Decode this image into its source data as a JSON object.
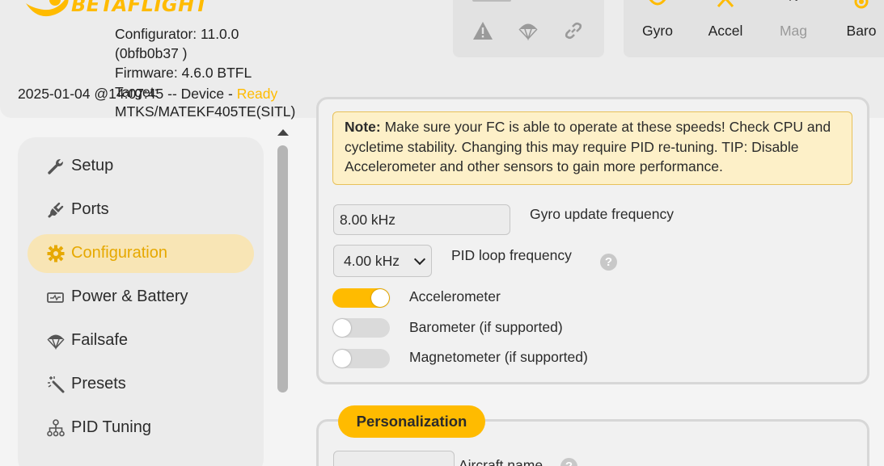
{
  "header": {
    "logo_text": "BETAFLIGHT",
    "configurator": "Configurator: 11.0.0",
    "build": "(0bfb0b37 )",
    "firmware": "Firmware: 4.6.0 BTFL",
    "target_label": "Target:",
    "target_value": "MTKS/MATEKF405TE(SITL)",
    "status_prefix": "2025-01-04 @14:07:45 -- Device - ",
    "status_ready": "Ready",
    "status_icons": [
      "warning-icon",
      "parachute-icon",
      "link-icon"
    ],
    "sensors": [
      {
        "label": "Gyro",
        "active": true
      },
      {
        "label": "Accel",
        "active": true
      },
      {
        "label": "Mag",
        "active": false
      },
      {
        "label": "Baro",
        "active": true
      }
    ]
  },
  "sidebar": {
    "items": [
      {
        "label": "Setup",
        "icon": "wrench-icon",
        "active": false
      },
      {
        "label": "Ports",
        "icon": "plug-icon",
        "active": false
      },
      {
        "label": "Configuration",
        "icon": "gear-icon",
        "active": true
      },
      {
        "label": "Power & Battery",
        "icon": "battery-icon",
        "active": false
      },
      {
        "label": "Failsafe",
        "icon": "parachute-icon",
        "active": false
      },
      {
        "label": "Presets",
        "icon": "magic-wand-icon",
        "active": false
      },
      {
        "label": "PID Tuning",
        "icon": "hierarchy-icon",
        "active": false
      }
    ]
  },
  "system": {
    "note_bold": "Note:",
    "note_text": " Make sure your FC is able to operate at these speeds! Check CPU and cycletime stability. Changing this may require PID re-tuning. TIP: Disable Accelerometer and other sensors to gain more performance.",
    "gyro_value": "8.00 kHz",
    "gyro_label": "Gyro update frequency",
    "pid_value": "4.00 kHz",
    "pid_label": "PID loop frequency",
    "help_glyph": "?",
    "toggles": [
      {
        "label": "Accelerometer",
        "on": true
      },
      {
        "label": "Barometer (if supported)",
        "on": false
      },
      {
        "label": "Magnetometer (if supported)",
        "on": false
      }
    ]
  },
  "personalization": {
    "title": "Personalization",
    "aircraft_label": "Aircraft name",
    "aircraft_value": ""
  },
  "colors": {
    "accent": "#ffbb00",
    "active_nav_bg": "#f8e5b5",
    "note_bg": "#fdf0c8"
  }
}
